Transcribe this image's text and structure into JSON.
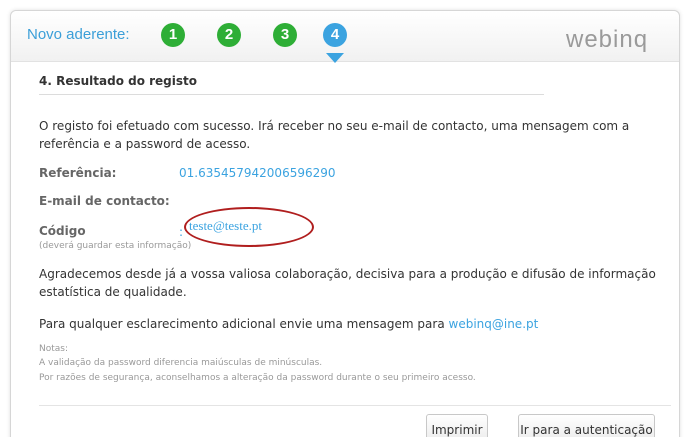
{
  "header": {
    "title": "Novo aderente:",
    "steps": [
      "1",
      "2",
      "3",
      "4"
    ],
    "logo": "webinq"
  },
  "section": {
    "title": "4. Resultado do registo"
  },
  "content": {
    "intro_line1": "O registo foi efetuado com sucesso. Irá receber no seu e-mail de contacto, uma mensagem com a",
    "intro_line2": "referência e a password de acesso.",
    "referencia_label": "Referência:",
    "referencia_value": "01.635457942006596290",
    "email_label": "E-mail de contacto:",
    "email_value": "teste@teste.pt",
    "codigo_label": "Código",
    "codigo_value": ": ",
    "codigo_hint": "(deverá guardar esta informação)",
    "thanks_line1": "Agradecemos desde já a vossa valiosa colaboração, decisiva para a produção e difusão de informação",
    "thanks_line2": "estatística de qualidade.",
    "contact_prefix": "Para qualquer esclarecimento adicional envie uma mensagem para ",
    "contact_email": "webinq@ine.pt",
    "notes_title": "Notas:",
    "note1": "A validação da password diferencia maiúsculas de minúsculas.",
    "note2": "Por razões de segurança, aconselhamos a alteração da password durante o seu primeiro acesso."
  },
  "buttons": {
    "print": "Imprimir",
    "auth": "Ir para a autenticação"
  },
  "colors": {
    "accent": "#3ba3e0",
    "step_done": "#2eae36",
    "highlight": "#b01e1e"
  }
}
